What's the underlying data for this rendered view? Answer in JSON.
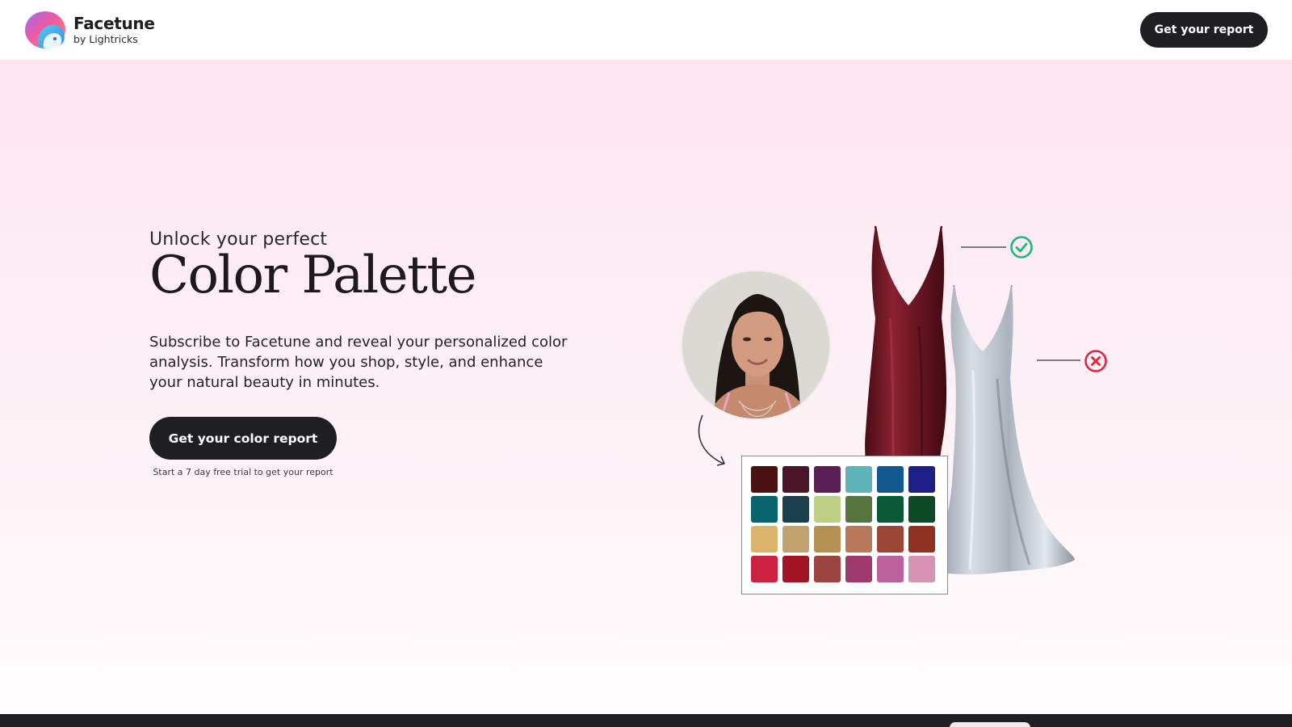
{
  "header": {
    "brand_name": "Facetune",
    "brand_by": "by Lightricks",
    "report_button": "Get your report"
  },
  "hero": {
    "eyebrow": "Unlock your perfect",
    "headline": "Color Palette",
    "lead": "Subscribe to Facetune and reveal your personalized color analysis. Transform how you shop, style, and enhance your natural beauty in minutes.",
    "cta_button": "Get your color report",
    "trial_note": "Start a 7 day free trial to get your report"
  },
  "palette": {
    "swatches": [
      "#4a1210",
      "#4b1528",
      "#5c1f54",
      "#5fb4b7",
      "#13578f",
      "#1d1f86",
      "#06646a",
      "#1a3f4d",
      "#bccf85",
      "#56753e",
      "#0a5a3a",
      "#0b4a26",
      "#dbb46b",
      "#c1a26f",
      "#b49052",
      "#b8785b",
      "#9a4535",
      "#8f3222",
      "#cb2240",
      "#a31424",
      "#9c4540",
      "#a03a6e",
      "#bb629e",
      "#d993b2"
    ]
  },
  "colors": {
    "check": "#1fb87a",
    "cross": "#e0263a",
    "dress_burgundy": "#6e1624",
    "dress_silver": "#b6bdc5",
    "button_dark": "#1f1f23"
  },
  "icons": {
    "logo": "facetune-logo",
    "check": "check-circle-icon",
    "cross": "x-circle-icon",
    "arrow": "curved-arrow-icon"
  }
}
